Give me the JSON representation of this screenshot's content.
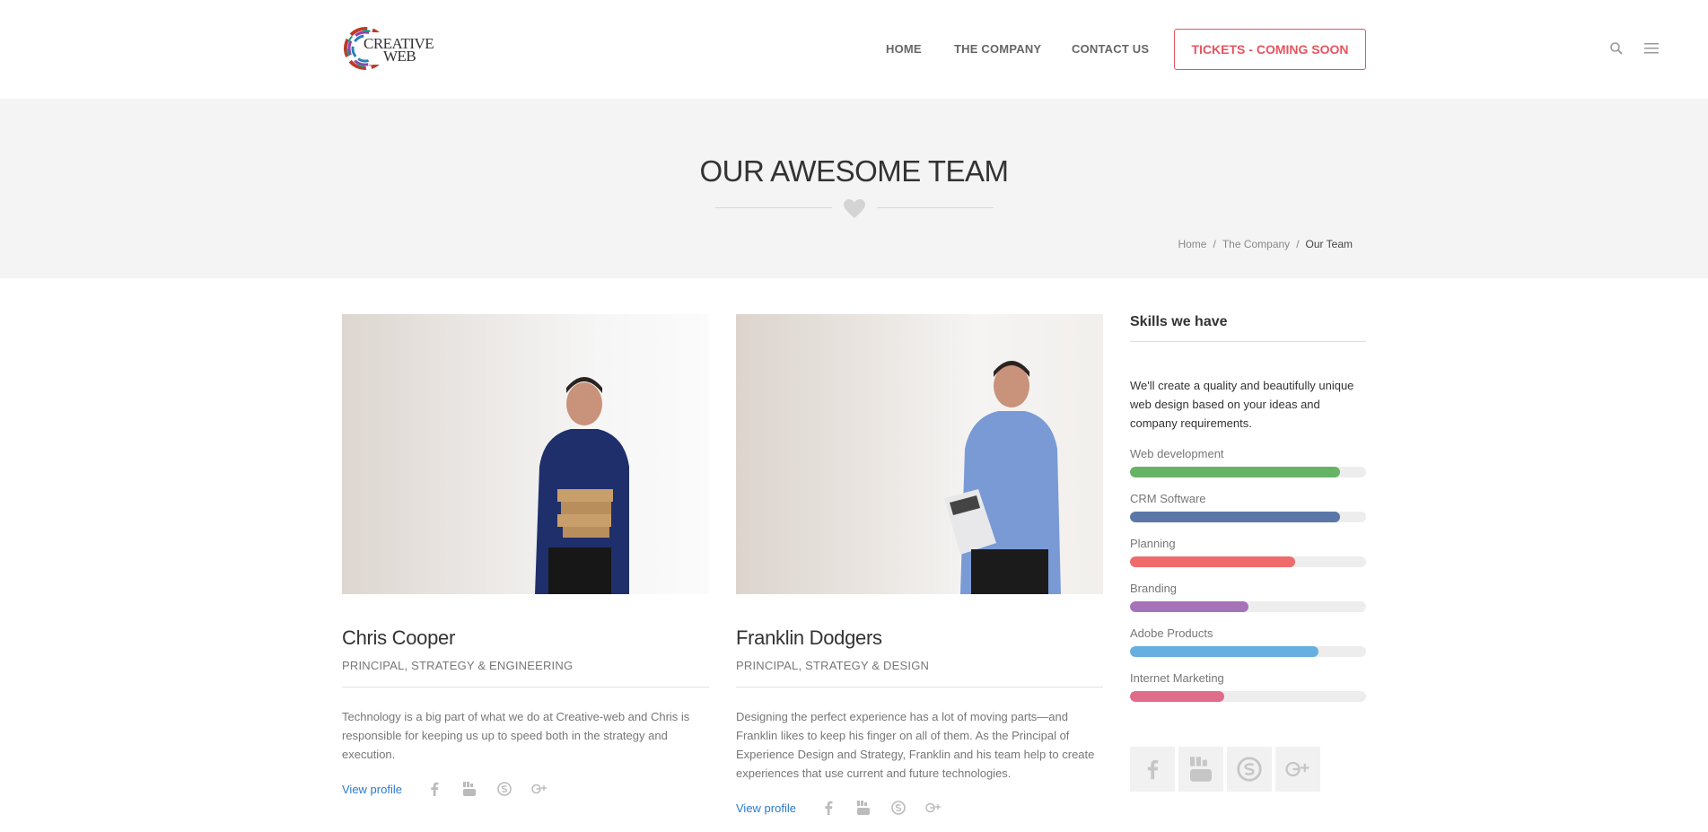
{
  "header": {
    "logo": {
      "line1": "CREATIVE",
      "line2": "WEB"
    },
    "nav": [
      {
        "label": "HOME"
      },
      {
        "label": "THE COMPANY"
      },
      {
        "label": "CONTACT US"
      }
    ],
    "tickets_label": "TICKETS - COMING SOON",
    "accent_color": "#e8545f"
  },
  "title_band": {
    "title": "OUR AWESOME TEAM",
    "breadcrumb": [
      "Home",
      "The Company",
      "Our Team"
    ],
    "breadcrumb_sep": "/"
  },
  "team": [
    {
      "name": "Chris Cooper",
      "role": "PRINCIPAL, STRATEGY & ENGINEERING",
      "description": "Technology is a big part of what we do at Creative-web and Chris is responsible for keeping us up to speed both in the strategy and execution.",
      "view_profile": "View profile",
      "social_icons": [
        "facebook-icon",
        "youtube-icon",
        "skype-icon",
        "google-plus-icon"
      ]
    },
    {
      "name": "Franklin Dodgers",
      "role": "PRINCIPAL, STRATEGY & DESIGN",
      "description": "Designing the perfect experience has a lot of moving parts—and Franklin likes to keep his finger on all of them. As the Principal of Experience Design and Strategy, Franklin and his team help to create experiences that use current and future technologies.",
      "view_profile": "View profile",
      "social_icons": [
        "facebook-icon",
        "youtube-icon",
        "skype-icon",
        "google-plus-icon"
      ]
    }
  ],
  "sidebar": {
    "title": "Skills we have",
    "text": "We'll create a quality and beautifully unique web design based on your ideas and company requirements.",
    "skills": [
      {
        "label": "Web development",
        "percent": 89,
        "color": "#66b366"
      },
      {
        "label": "CRM Software",
        "percent": 89,
        "color": "#5a77a8"
      },
      {
        "label": "Planning",
        "percent": 70,
        "color": "#ef6b6b"
      },
      {
        "label": "Branding",
        "percent": 50,
        "color": "#a672b8"
      },
      {
        "label": "Adobe Products",
        "percent": 80,
        "color": "#66afe0"
      },
      {
        "label": "Internet Marketing",
        "percent": 40,
        "color": "#e06c8c"
      }
    ],
    "social_icons": [
      "facebook-icon",
      "youtube-icon",
      "skype-icon",
      "google-plus-icon"
    ]
  }
}
